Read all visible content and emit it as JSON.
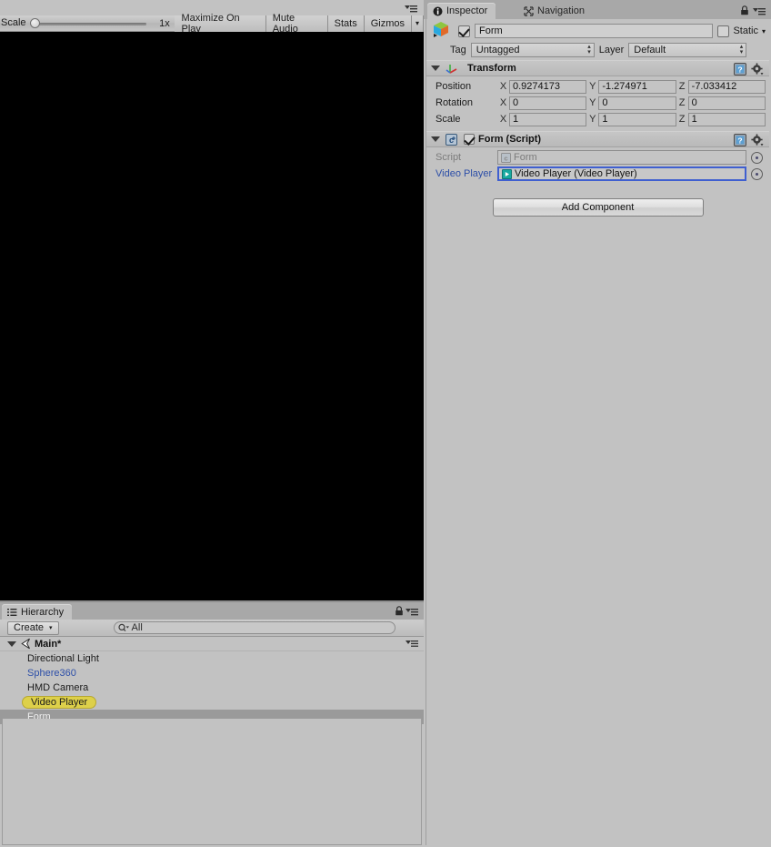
{
  "app": {
    "editor": "Unity Editor"
  },
  "game_view": {
    "scale_label": "Scale",
    "scale_value": "1x",
    "slider_position_pct": 0,
    "buttons": [
      {
        "label": "Maximize On Play",
        "name": "maximize-on-play-button"
      },
      {
        "label": "Mute Audio",
        "name": "mute-audio-button"
      },
      {
        "label": "Stats",
        "name": "stats-button"
      },
      {
        "label": "Gizmos",
        "name": "gizmos-button"
      }
    ],
    "gizmos_dropdown_glyph": "▾",
    "canvas_color": "#000000",
    "panel_menu_icon": "panel-menu-icon"
  },
  "hierarchy": {
    "tab_label": "Hierarchy",
    "tab_icon": "hierarchy-icon",
    "create_label": "Create",
    "create_arrow": "▾",
    "search_placeholder": "All",
    "search_value": "All",
    "search_icon": "search-icon",
    "lock_icon": "lock-icon",
    "menu_icon": "panel-menu-icon",
    "scene_name": "Main*",
    "scene_icon": "unity-scene-icon",
    "scene_expanded": true,
    "items": [
      {
        "label": "Directional Light",
        "style": "normal",
        "selected": false
      },
      {
        "label": "Sphere360",
        "style": "prefab",
        "selected": false
      },
      {
        "label": "HMD Camera",
        "style": "normal",
        "selected": false
      },
      {
        "label": "Video Player",
        "style": "pill",
        "selected": false
      },
      {
        "label": "Form",
        "style": "normal",
        "selected": true
      }
    ]
  },
  "inspector": {
    "tabs": [
      {
        "label": "Inspector",
        "icon": "info-icon",
        "active": true
      },
      {
        "label": "Navigation",
        "icon": "navigation-icon",
        "active": false
      }
    ],
    "lock_icon": "lock-icon",
    "menu_icon": "panel-menu-icon",
    "game_object": {
      "icon": "gameobject-cube-icon",
      "enabled": true,
      "name": "Form",
      "static_label": "Static",
      "static_checked": false,
      "static_arrow": "▾",
      "tag_label": "Tag",
      "tag_value": "Untagged",
      "layer_label": "Layer",
      "layer_value": "Default"
    },
    "components": [
      {
        "title": "Transform",
        "icon": "transform-axis-icon",
        "expanded": true,
        "has_checkbox": false,
        "help_icon": "help-icon",
        "gear_icon": "gear-icon",
        "rows": [
          {
            "label": "Position",
            "x": "0.9274173",
            "y": "-1.274971",
            "z": "-7.033412"
          },
          {
            "label": "Rotation",
            "x": "0",
            "y": "0",
            "z": "0"
          },
          {
            "label": "Scale",
            "x": "1",
            "y": "1",
            "z": "1"
          }
        ],
        "axis_labels": [
          "X",
          "Y",
          "Z"
        ]
      },
      {
        "title": "Form (Script)",
        "icon": "cs-script-icon",
        "expanded": true,
        "has_checkbox": true,
        "checked": true,
        "help_icon": "help-icon",
        "gear_icon": "gear-icon",
        "object_rows": [
          {
            "label": "Script",
            "value": "Form",
            "icon": "cs-script-icon",
            "disabled": true,
            "highlight": false
          },
          {
            "label": "Video Player",
            "value": "Video Player (Video Player)",
            "icon": "video-player-icon",
            "disabled": false,
            "highlight": true
          }
        ]
      }
    ],
    "add_component_label": "Add Component"
  },
  "colors": {
    "panel_bg": "#c2c2c2",
    "tabbar_bg": "#a8a8a8",
    "selection": "#9a9a9a",
    "pill_yellow": "#ddd04a",
    "link_blue": "#2d4fa8",
    "highlight_border": "#3f5fd0",
    "canvas_black": "#000000"
  }
}
